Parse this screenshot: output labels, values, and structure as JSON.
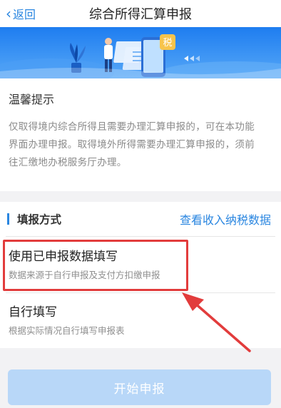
{
  "navbar": {
    "back_label": "返回",
    "title": "综合所得汇算申报"
  },
  "banner": {
    "tax_char": "税"
  },
  "notice": {
    "title": "温馨提示",
    "lines": [
      "仅取得境内综合所得且需要办理汇算申报的，可在本功能",
      "界面办理申报。取得境外所得需要办理汇算申报的，须前",
      "往汇缴地办税服务厅办理。"
    ]
  },
  "fill_method": {
    "title": "填报方式",
    "link": "查看收入纳税数据",
    "options": [
      {
        "title": "使用已申报数据填写",
        "desc": "数据来源于自行申报及支付方扣缴申报"
      },
      {
        "title": "自行填写",
        "desc": "根据实际情况自行填写申报表"
      }
    ]
  },
  "start_button": "开始申报",
  "colors": {
    "accent": "#2a86e0",
    "highlight": "#e23c3c",
    "button_disabled": "#b8d7f8"
  }
}
